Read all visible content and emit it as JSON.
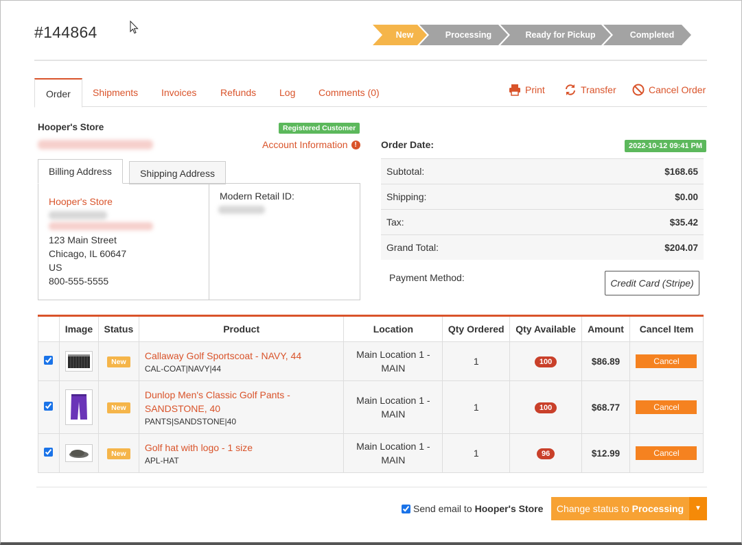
{
  "order": {
    "number": "#144864"
  },
  "status_steps": [
    "New",
    "Processing",
    "Ready for Pickup",
    "Completed"
  ],
  "tabs": [
    "Order",
    "Shipments",
    "Invoices",
    "Refunds",
    "Log",
    "Comments (0)"
  ],
  "actions": {
    "print": "Print",
    "transfer": "Transfer",
    "cancel_order": "Cancel Order"
  },
  "customer": {
    "name": "Hooper's Store",
    "badge": "Registered Customer",
    "account_info": "Account Information"
  },
  "address_tabs": {
    "billing": "Billing Address",
    "shipping": "Shipping Address"
  },
  "billing": {
    "name": "Hooper's Store",
    "street": "123 Main Street",
    "city_state": "Chicago, IL 60647",
    "country": "US",
    "phone": "800-555-5555"
  },
  "modern_retail_id_label": "Modern Retail ID:",
  "order_date": {
    "label": "Order Date:",
    "value": "2022-10-12 09:41 PM"
  },
  "totals": [
    {
      "label": "Subtotal:",
      "value": "$168.65"
    },
    {
      "label": "Shipping:",
      "value": "$0.00"
    },
    {
      "label": "Tax:",
      "value": "$35.42"
    },
    {
      "label": "Grand Total:",
      "value": "$204.07"
    }
  ],
  "payment": {
    "label": "Payment Method:",
    "value": "Credit Card (Stripe)"
  },
  "items_table": {
    "headers": [
      "",
      "Image",
      "Status",
      "Product",
      "Location",
      "Qty Ordered",
      "Qty Available",
      "Amount",
      "Cancel Item"
    ],
    "rows": [
      {
        "status": "New",
        "product": "Callaway Golf Sportscoat - NAVY, 44",
        "sku": "CAL-COAT|NAVY|44",
        "location": "Main Location 1 - MAIN",
        "qty_ordered": "1",
        "qty_available": "100",
        "amount": "$86.89",
        "cancel": "Cancel",
        "image": "sportscoat-thumbnail"
      },
      {
        "status": "New",
        "product": "Dunlop Men's Classic Golf Pants - SANDSTONE, 40",
        "sku": "PANTS|SANDSTONE|40",
        "location": "Main Location 1 - MAIN",
        "qty_ordered": "1",
        "qty_available": "100",
        "amount": "$68.77",
        "cancel": "Cancel",
        "image": "pants-thumbnail"
      },
      {
        "status": "New",
        "product": "Golf hat with logo - 1 size",
        "sku": "APL-HAT",
        "location": "Main Location 1 - MAIN",
        "qty_ordered": "1",
        "qty_available": "96",
        "amount": "$12.99",
        "cancel": "Cancel",
        "image": "hat-thumbnail"
      }
    ]
  },
  "footer": {
    "send_email_prefix": "Send email to",
    "send_email_name": "Hooper's Store",
    "change_status_prefix": "Change status to",
    "change_status_target": "Processing"
  },
  "colors": {
    "accent": "#d9532a",
    "step_active": "#f5b54a",
    "step_inactive": "#a3a3a3",
    "success": "#5cb85c",
    "button": "#f7a234",
    "danger_badge": "#c9402a"
  }
}
